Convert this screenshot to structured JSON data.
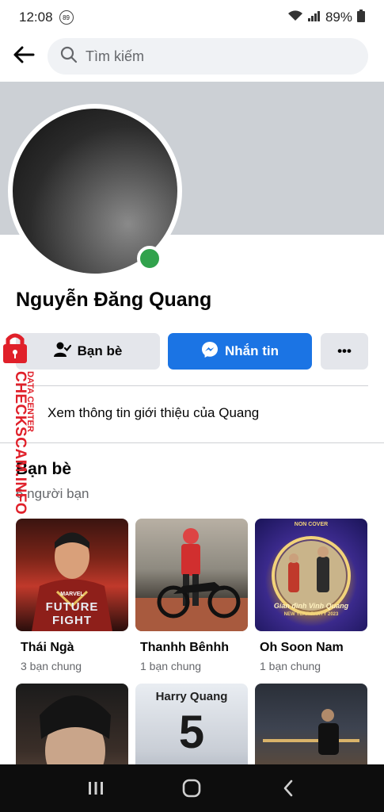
{
  "status_bar": {
    "time": "12:08",
    "notification_badge": "89",
    "battery": "89%"
  },
  "search": {
    "placeholder": "Tìm kiếm"
  },
  "profile": {
    "name": "Nguyễn Đăng Quang",
    "online": true
  },
  "actions": {
    "friends_label": "Bạn bè",
    "message_label": "Nhắn tin",
    "more_label": "•••"
  },
  "about": {
    "label": "Xem thông tin giới thiệu của Quang"
  },
  "friends_section": {
    "title": "Bạn bè",
    "count_text": "6 người bạn",
    "friends": [
      {
        "name": "Thái Ngà",
        "mutual": "3 bạn chung"
      },
      {
        "name": "Thanhh Bênhh",
        "mutual": "1 bạn chung"
      },
      {
        "name": "Oh Soon Nam",
        "mutual": "1 bạn chung"
      }
    ],
    "photo_texts": {
      "future_fight_brand": "MARVEL",
      "future_fight_title_1": "FUTURE",
      "future_fight_title_2": "FIGHT",
      "party_brand": "NON COVER",
      "party_script": "Gian đình Vinh Quang",
      "party_banner": "NEW YEAR PARTY 2023",
      "jersey_name": "Harry Quang",
      "jersey_number": "5"
    }
  },
  "watermark": {
    "brand": "CHECKSCAM.INFO",
    "tagline": "DATA CENTER"
  },
  "colors": {
    "primary": "#1b74e4",
    "online": "#31a24c",
    "button_grey": "#e4e6eb",
    "watermark_red": "#e0202a"
  },
  "icons": {
    "back": "arrow-left-icon",
    "search": "search-icon",
    "friends": "person-check-icon",
    "messenger": "messenger-icon",
    "about": "info-icon"
  }
}
